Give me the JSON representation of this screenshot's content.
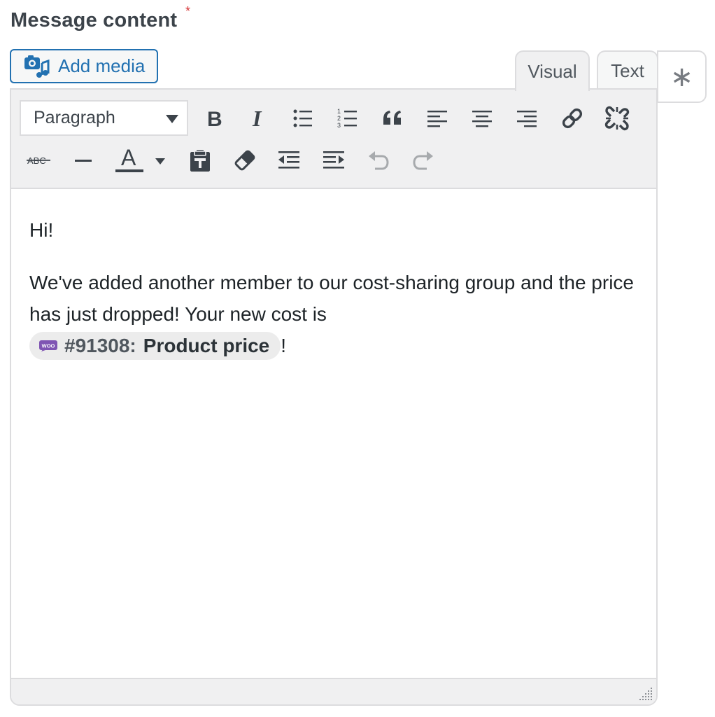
{
  "field": {
    "label": "Message content",
    "required_marker": "*"
  },
  "media": {
    "add_label": "Add media"
  },
  "tabs": [
    {
      "label": "Visual",
      "active": true
    },
    {
      "label": "Text",
      "active": false
    }
  ],
  "extra_button": {
    "label": "∗"
  },
  "toolbar": {
    "format": {
      "selected": "Paragraph"
    },
    "row1_buttons": [
      "bold-icon",
      "italic-icon",
      "bullet-list-icon",
      "numbered-list-icon",
      "blockquote-icon",
      "align-left-icon",
      "align-center-icon",
      "align-right-icon",
      "link-icon",
      "unlink-icon"
    ],
    "row2_buttons": [
      "strikethrough-icon",
      "horizontal-line-icon",
      "text-color-icon",
      "paste-text-icon",
      "clear-formatting-icon",
      "outdent-icon",
      "indent-icon",
      "undo-icon",
      "redo-icon"
    ]
  },
  "content": {
    "greeting": "Hi!",
    "body_text": "We've added another member to our cost-sharing group and the price has just dropped! Your new cost is",
    "merge_tag": {
      "icon_text": "WOO",
      "id": "#91308:",
      "name": "Product price"
    },
    "trailing": "!"
  },
  "colors": {
    "accent": "#2271b1",
    "toolbar_bg": "#f0f0f1",
    "border": "#dcdcde",
    "required": "#d63638",
    "woo_purple": "#7f54b3"
  }
}
